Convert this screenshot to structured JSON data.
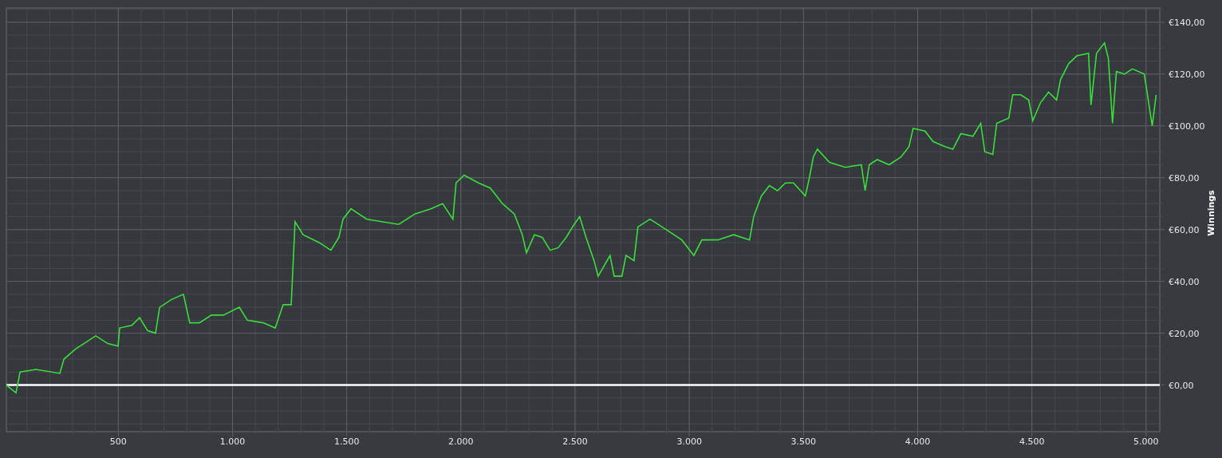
{
  "chart_data": {
    "type": "line",
    "ylabel": "Winnings",
    "x": [
      10,
      52,
      70,
      140,
      244,
      262,
      314,
      367,
      401,
      454,
      499,
      506,
      559,
      593,
      628,
      663,
      681,
      733,
      785,
      813,
      855,
      908,
      960,
      1030,
      1065,
      1135,
      1187,
      1222,
      1257,
      1274,
      1309,
      1379,
      1431,
      1466,
      1484,
      1519,
      1588,
      1658,
      1728,
      1798,
      1868,
      1920,
      1965,
      1979,
      2014,
      2077,
      2129,
      2182,
      2234,
      2269,
      2287,
      2322,
      2356,
      2391,
      2426,
      2461,
      2496,
      2520,
      2548,
      2583,
      2601,
      2653,
      2671,
      2705,
      2723,
      2758,
      2775,
      2828,
      2898,
      2967,
      3020,
      3055,
      3125,
      3194,
      3264,
      3282,
      3316,
      3351,
      3386,
      3421,
      3456,
      3508,
      3526,
      3543,
      3561,
      3613,
      3683,
      3753,
      3770,
      3788,
      3823,
      3875,
      3927,
      3962,
      3980,
      4032,
      4067,
      4119,
      4154,
      4189,
      4242,
      4276,
      4294,
      4329,
      4346,
      4399,
      4416,
      4451,
      4486,
      4504,
      4538,
      4573,
      4608,
      4626,
      4661,
      4696,
      4748,
      4759,
      4783,
      4818,
      4835,
      4853,
      4870,
      4905,
      4940,
      4992,
      5027,
      5044
    ],
    "series": [
      {
        "color": "#3ddc3d",
        "values": [
          0,
          -3,
          5,
          6,
          4.5,
          10,
          14,
          17,
          19,
          16,
          15,
          22,
          23,
          26,
          21,
          20,
          30,
          33,
          35,
          24,
          24,
          27,
          27,
          30,
          25,
          24,
          22,
          31,
          31,
          63,
          58,
          55,
          52,
          57,
          64,
          68,
          64,
          63,
          62,
          66,
          68,
          70,
          64,
          78,
          81,
          78,
          76,
          70,
          66,
          58,
          51,
          58,
          57,
          52,
          53,
          57,
          62,
          65,
          57,
          48,
          42,
          50,
          42,
          42,
          50,
          48,
          61,
          64,
          60,
          56,
          50,
          56,
          56,
          58,
          56,
          65,
          73,
          77,
          75,
          78,
          78,
          73,
          80,
          88,
          91,
          86,
          84,
          85,
          75,
          85,
          87,
          85,
          88,
          92,
          99,
          98,
          94,
          92,
          91,
          97,
          96,
          101,
          90,
          89,
          101,
          103,
          112,
          112,
          110,
          102,
          109,
          113,
          110,
          118,
          124,
          127,
          128,
          108,
          128,
          132,
          126,
          101,
          121,
          120,
          122,
          120,
          100,
          112
        ]
      }
    ],
    "grid": true,
    "xlim": [
      10,
      5060
    ],
    "ylim": [
      -18,
      145.5
    ],
    "xticks": [
      {
        "value": 500,
        "label": "500"
      },
      {
        "value": 1000,
        "label": "1.000"
      },
      {
        "value": 1500,
        "label": "1.500"
      },
      {
        "value": 2000,
        "label": "2.000"
      },
      {
        "value": 2500,
        "label": "2.500"
      },
      {
        "value": 3000,
        "label": "3.000"
      },
      {
        "value": 3500,
        "label": "3.500"
      },
      {
        "value": 4000,
        "label": "4.000"
      },
      {
        "value": 4500,
        "label": "4.500"
      },
      {
        "value": 5000,
        "label": "5.000"
      }
    ],
    "yticks": [
      {
        "value": 0,
        "label": "€0,00"
      },
      {
        "value": 20,
        "label": "€20,00"
      },
      {
        "value": 40,
        "label": "€40,00"
      },
      {
        "value": 60,
        "label": "€60,00"
      },
      {
        "value": 80,
        "label": "€80,00"
      },
      {
        "value": 100,
        "label": "€100,00"
      },
      {
        "value": 120,
        "label": "€120,00"
      },
      {
        "value": 140,
        "label": "€140,00"
      }
    ]
  }
}
